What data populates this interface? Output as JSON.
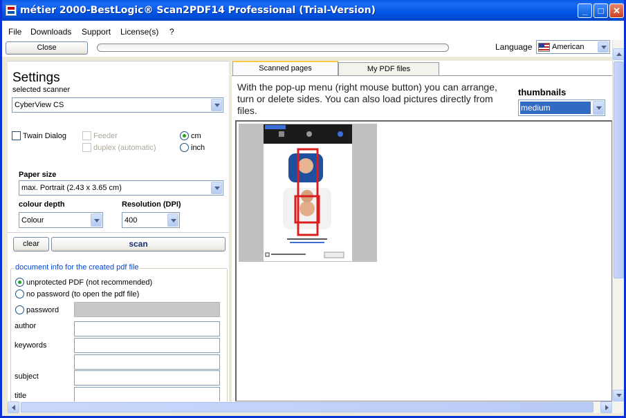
{
  "window": {
    "title": "métier 2000-BestLogic® Scan2PDF14 Professional (Trial-Version)"
  },
  "titlebar_buttons": {
    "minimize": "_",
    "maximize": "□",
    "close": "✕"
  },
  "menu": [
    "File",
    "Downloads",
    "Support",
    "License(s)",
    "?"
  ],
  "toolbar": {
    "close_label": "Close",
    "progress": 0,
    "language_label": "Language",
    "language_value": "American"
  },
  "settings": {
    "title": "Settings",
    "selected_scanner_label": "selected scanner",
    "scanner_value": "CyberView CS",
    "twain_dialog": {
      "label": "Twain Dialog",
      "checked": false
    },
    "feeder": {
      "label": "Feeder",
      "checked": false,
      "enabled": false
    },
    "duplex": {
      "label": "duplex (automatic)",
      "checked": false,
      "enabled": false
    },
    "units": [
      {
        "label": "cm",
        "selected": true
      },
      {
        "label": "inch",
        "selected": false
      }
    ],
    "paper_size_label": "Paper size",
    "paper_size_value": "max. Portrait (2.43 x 3.65 cm)",
    "colour_depth_label": "colour depth",
    "colour_depth_value": "Colour",
    "resolution_label": "Resolution (DPI)",
    "resolution_value": "400",
    "clear_label": "clear",
    "scan_label": "scan"
  },
  "docinfo": {
    "legend": "document info for the created pdf file",
    "options": [
      {
        "label": "unprotected PDF (not recommended)",
        "selected": true
      },
      {
        "label": "no password (to open the pdf file)",
        "selected": false
      },
      {
        "label": "password",
        "selected": false
      }
    ],
    "author_label": "author",
    "keywords_label": "keywords",
    "subject_label": "subject",
    "title_label": "title"
  },
  "tabs": [
    {
      "label": "Scanned pages",
      "active": true
    },
    {
      "label": "My PDF files",
      "active": false
    }
  ],
  "main": {
    "info": "With the pop-up menu (right mouse button) you can arrange, turn or delete sides. You can also load pictures directly from files.",
    "thumbnails_label": "thumbnails",
    "thumbnails_value": "medium"
  },
  "colors": {
    "title_blue": "#0055e5",
    "face_bg": "#ece9d8",
    "selection": "#316ac5",
    "photo_frame": "#d81e1e"
  }
}
